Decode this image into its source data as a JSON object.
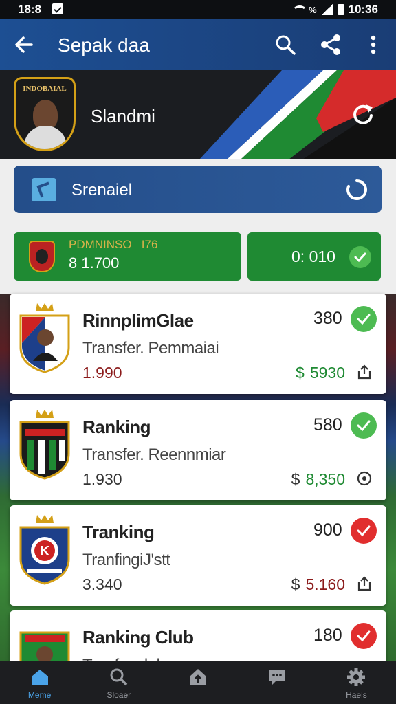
{
  "status_bar": {
    "time": "18:8",
    "right_time": "10:36",
    "battery_text": "%"
  },
  "app_bar": {
    "title": "Sepak daa",
    "back_icon": "back-arrow-icon",
    "icons": [
      "search-icon",
      "share-icon",
      "more-vert-icon"
    ]
  },
  "hero": {
    "badge_text": "INDOBAIAL",
    "name": "Slandmi",
    "refresh_icon": "refresh-icon"
  },
  "search_card": {
    "label": "Srenaiel",
    "icon": "cursor-icon",
    "action_icon": "loading-spinner-icon"
  },
  "stats": {
    "left": {
      "label": "PDMNINSO",
      "label2": "I76",
      "value": "8 1.700"
    },
    "right": {
      "value": "0: 010",
      "status": "check"
    }
  },
  "cards": [
    {
      "name": "RinnplimGlae",
      "subtitle": "Transfer. Pemmaiai",
      "value": "1.990",
      "score": "380",
      "status": "ok",
      "currency": "$",
      "price": "5930",
      "action_icon": "share-out-icon"
    },
    {
      "name": "Ranking",
      "subtitle": "Transfer. Reennmiar",
      "value": "1.930",
      "score": "580",
      "status": "ok",
      "currency": "$",
      "price": "8,350",
      "action_icon": "target-icon"
    },
    {
      "name": "Tranking",
      "subtitle": "TranfingiJ'stt",
      "value": "3.340",
      "score": "900",
      "status": "bad",
      "currency": "$",
      "price": "5.160",
      "action_icon": "share-out-icon"
    },
    {
      "name": "Ranking Club",
      "subtitle": "Tranfcoglah",
      "value": "",
      "score": "180",
      "status": "bad",
      "currency": "",
      "price": "",
      "action_icon": ""
    }
  ],
  "bottom_nav": [
    {
      "label": "Meme",
      "icon": "home-icon",
      "active": true
    },
    {
      "label": "Sloaer",
      "icon": "search-icon",
      "active": false
    },
    {
      "label": "",
      "icon": "house-up-icon",
      "active": false
    },
    {
      "label": "",
      "icon": "chat-icon",
      "active": false
    },
    {
      "label": "Haels",
      "icon": "settings-icon",
      "active": false
    }
  ],
  "colors": {
    "primary": "#1d4f93",
    "success": "#4dbb52",
    "danger": "#e12e2e",
    "field_green": "#1f8a33"
  }
}
